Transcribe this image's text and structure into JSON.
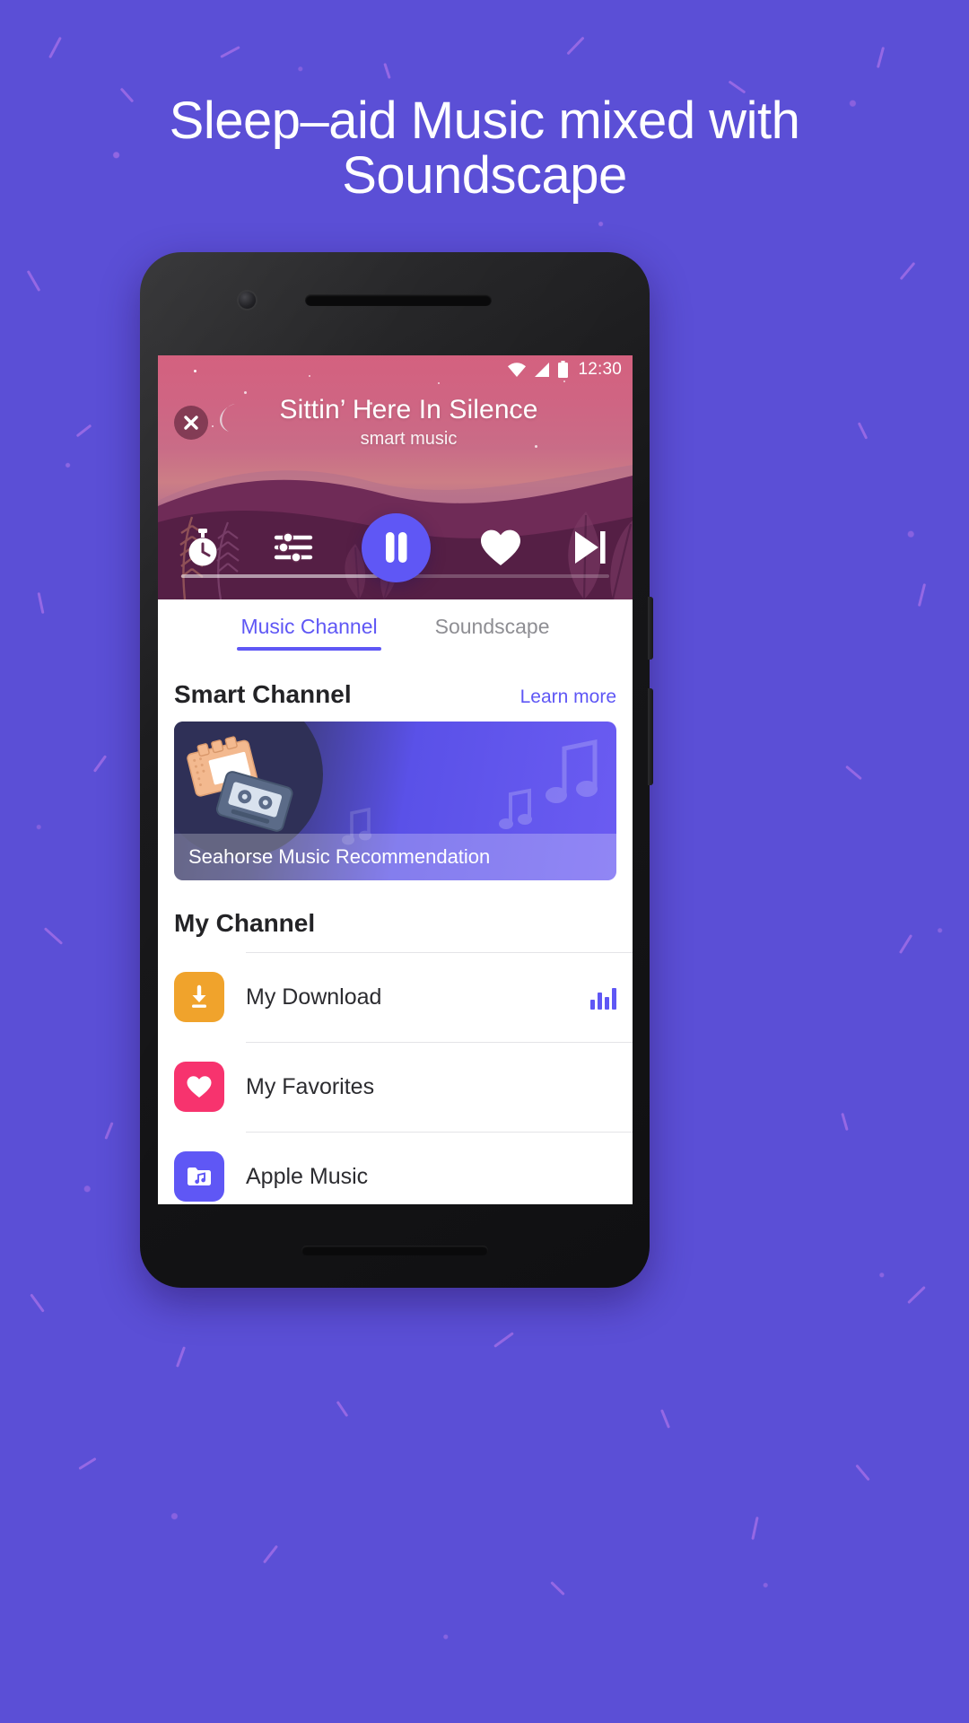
{
  "page": {
    "headline": "Sleep–aid Music mixed with Soundscape",
    "background_color": "#5b4fd6",
    "accent_color": "#5f57f5"
  },
  "statusbar": {
    "time": "12:30",
    "icons": [
      "wifi-icon",
      "signal-icon",
      "battery-icon"
    ]
  },
  "player": {
    "close_icon": "close-icon",
    "moon_icon": "moon-icon",
    "track_title": "Sittin’ Here In Silence",
    "track_artist": "smart music",
    "controls": [
      {
        "name": "sleep-timer-button",
        "icon": "stopwatch-icon"
      },
      {
        "name": "equalizer-button",
        "icon": "sliders-icon"
      },
      {
        "name": "play-pause-button",
        "icon": "pause-icon"
      },
      {
        "name": "favorite-button",
        "icon": "heart-icon"
      },
      {
        "name": "next-track-button",
        "icon": "skip-next-icon"
      }
    ]
  },
  "tabs": [
    {
      "label": "Music Channel",
      "active": true
    },
    {
      "label": "Soundscape",
      "active": false
    }
  ],
  "smart_channel": {
    "title": "Smart Channel",
    "learn_more": "Learn more",
    "card_label": "Seahorse Music Recommendation",
    "card_art_icon": "cassette-tape-icon"
  },
  "my_channel": {
    "title": "My Channel",
    "items": [
      {
        "label": "My Download",
        "icon": "download-icon",
        "icon_color": "#f0a32c",
        "trailing": "equalizer-playing-indicator"
      },
      {
        "label": "My Favorites",
        "icon": "heart-icon",
        "icon_color": "#f7336e",
        "trailing": ""
      },
      {
        "label": "Apple Music",
        "icon": "music-folder-icon",
        "icon_color": "#5f57f5",
        "trailing": ""
      }
    ]
  }
}
